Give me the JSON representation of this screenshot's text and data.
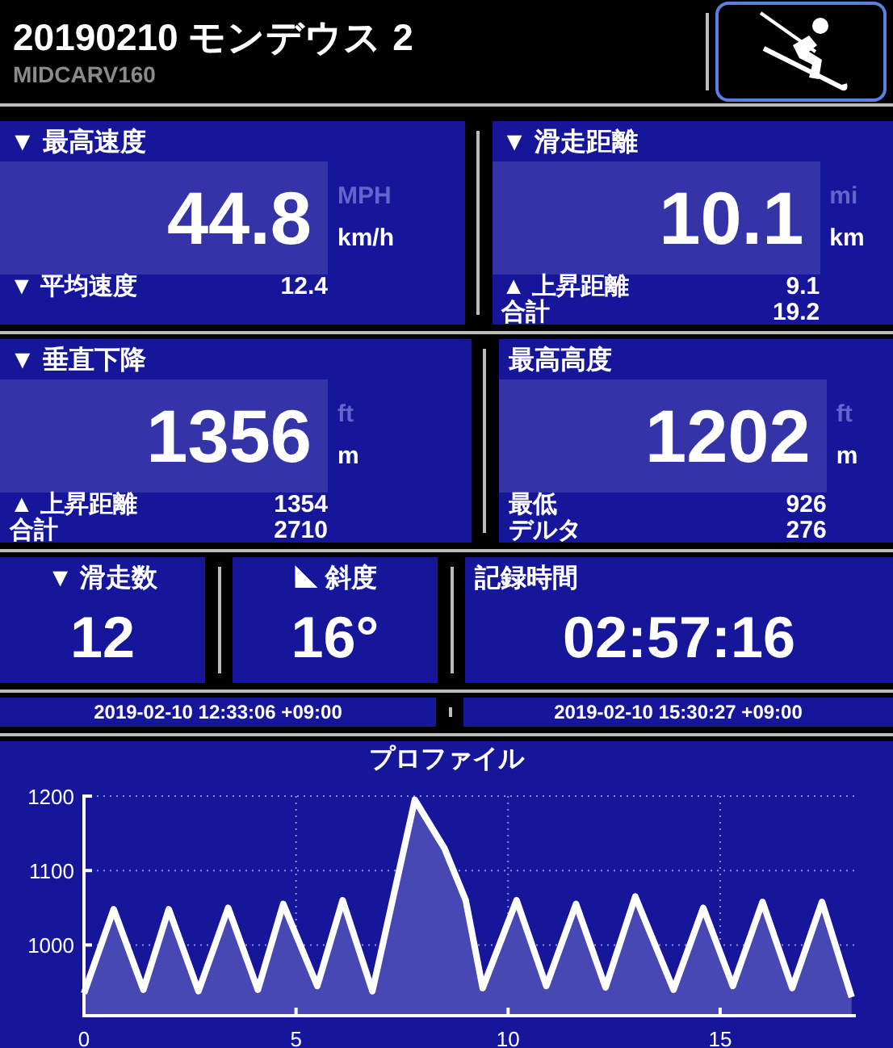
{
  "header": {
    "title": "20190210 モンデウス 2",
    "subtitle": "MIDCARV160"
  },
  "panels": [
    {
      "label": "▼ 最高速度",
      "value": "44.8",
      "units": [
        {
          "label": "MPH",
          "selected": false
        },
        {
          "label": "km/h",
          "selected": true
        }
      ],
      "rows": [
        {
          "label": "▼ 平均速度",
          "value": "12.4"
        }
      ]
    },
    {
      "label": "▼ 滑走距離",
      "value": "10.1",
      "units": [
        {
          "label": "mi",
          "selected": false
        },
        {
          "label": "km",
          "selected": true
        }
      ],
      "rows": [
        {
          "label": "▲ 上昇距離",
          "value": "9.1"
        },
        {
          "label": "合計",
          "value": "19.2"
        }
      ]
    },
    {
      "label": "▼ 垂直下降",
      "value": "1356",
      "units": [
        {
          "label": "ft",
          "selected": false
        },
        {
          "label": "m",
          "selected": true
        }
      ],
      "rows": [
        {
          "label": "▲ 上昇距離",
          "value": "1354"
        },
        {
          "label": "合計",
          "value": "2710"
        }
      ]
    },
    {
      "label": "最高高度",
      "value": "1202",
      "units": [
        {
          "label": "ft",
          "selected": false
        },
        {
          "label": "m",
          "selected": true
        }
      ],
      "rows": [
        {
          "label": "最低",
          "value": "926"
        },
        {
          "label": "デルタ",
          "value": "276"
        }
      ]
    }
  ],
  "stats": [
    {
      "label": "▼ 滑走数",
      "value": "12"
    },
    {
      "label": "◣ 斜度",
      "value": "16°"
    },
    {
      "label": "記録時間",
      "value": "02:57:16"
    }
  ],
  "times": [
    "2019-02-10 12:33:06 +09:00",
    "2019-02-10 15:30:27 +09:00"
  ],
  "profile": {
    "chart_data": {
      "type": "area",
      "title": "プロファイル",
      "grid": true,
      "xlim": [
        0,
        18.2
      ],
      "ylim": [
        905,
        1200
      ],
      "xticks": [
        0,
        5,
        10,
        15
      ],
      "yticks": [
        1000,
        1100,
        1200
      ],
      "x": [
        0,
        0.7,
        1.4,
        2.0,
        2.7,
        3.4,
        4.1,
        4.7,
        5.5,
        6.1,
        6.8,
        7.8,
        8.5,
        9.0,
        9.4,
        10.2,
        10.9,
        11.6,
        12.3,
        13.0,
        13.9,
        14.6,
        15.3,
        16.0,
        16.7,
        17.4,
        18.1
      ],
      "series": [
        {
          "color": "#ffffff",
          "values": [
            935,
            1048,
            940,
            1048,
            938,
            1050,
            940,
            1055,
            945,
            1060,
            938,
            1195,
            1130,
            1060,
            942,
            1060,
            945,
            1055,
            943,
            1065,
            940,
            1050,
            945,
            1058,
            942,
            1058,
            930
          ]
        }
      ]
    }
  }
}
